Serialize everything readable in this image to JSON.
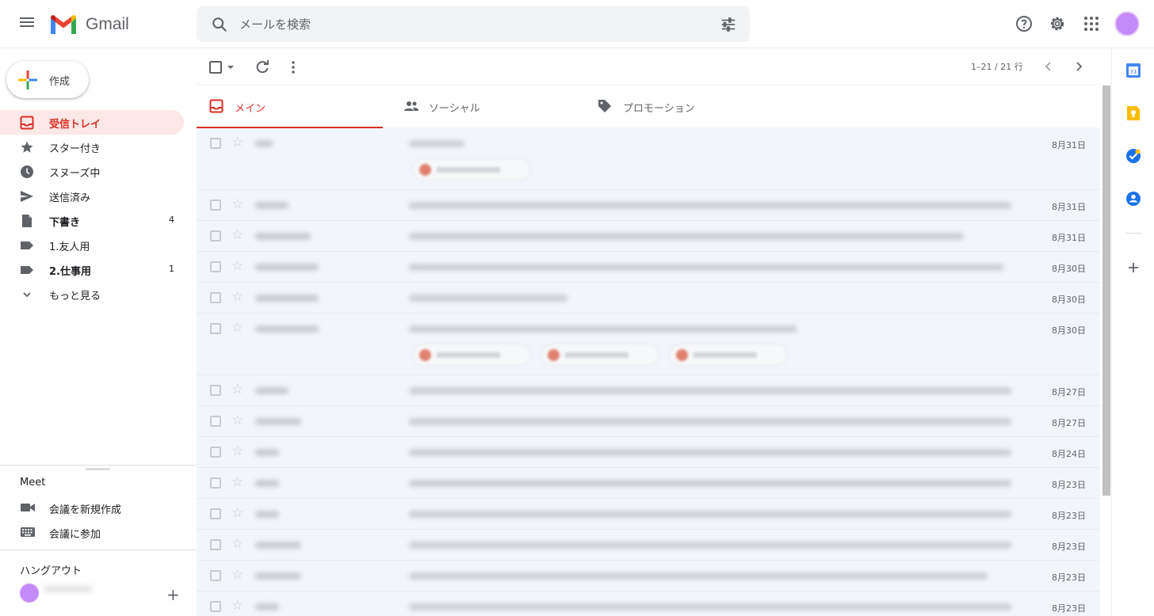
{
  "app": {
    "name": "Gmail"
  },
  "search": {
    "placeholder": "メールを検索"
  },
  "compose": {
    "label": "作成"
  },
  "nav": [
    {
      "label": "受信トレイ",
      "count": "",
      "icon": "inbox-icon"
    },
    {
      "label": "スター付き",
      "count": "",
      "icon": "star-icon"
    },
    {
      "label": "スヌーズ中",
      "count": "",
      "icon": "clock-icon"
    },
    {
      "label": "送信済み",
      "count": "",
      "icon": "send-icon"
    },
    {
      "label": "下書き",
      "count": "4",
      "icon": "draft-icon"
    },
    {
      "label": "1.友人用",
      "count": "",
      "icon": "label-icon"
    },
    {
      "label": "2.仕事用",
      "count": "1",
      "icon": "label-icon"
    },
    {
      "label": "もっと見る",
      "count": "",
      "icon": "chevron-down-icon"
    }
  ],
  "meet": {
    "title": "Meet",
    "new_meeting": "会議を新規作成",
    "join": "会議に参加"
  },
  "hangouts": {
    "title": "ハングアウト"
  },
  "toolbar": {
    "pager": "1–21 / 21 行"
  },
  "tabs": [
    {
      "label": "メイン"
    },
    {
      "label": "ソーシャル"
    },
    {
      "label": "プロモーション"
    }
  ],
  "emails": [
    {
      "date": "8月31日"
    },
    {
      "date": "8月31日"
    },
    {
      "date": "8月31日"
    },
    {
      "date": "8月30日"
    },
    {
      "date": "8月30日"
    },
    {
      "date": "8月30日"
    },
    {
      "date": "8月27日"
    },
    {
      "date": "8月27日"
    },
    {
      "date": "8月24日"
    },
    {
      "date": "8月23日"
    },
    {
      "date": "8月23日"
    },
    {
      "date": "8月23日"
    },
    {
      "date": "8月23日"
    },
    {
      "date": "8月23日"
    }
  ],
  "colors": {
    "accent": "#d93025",
    "active_bg": "#fce8e6",
    "avatar": "#c58af9"
  }
}
